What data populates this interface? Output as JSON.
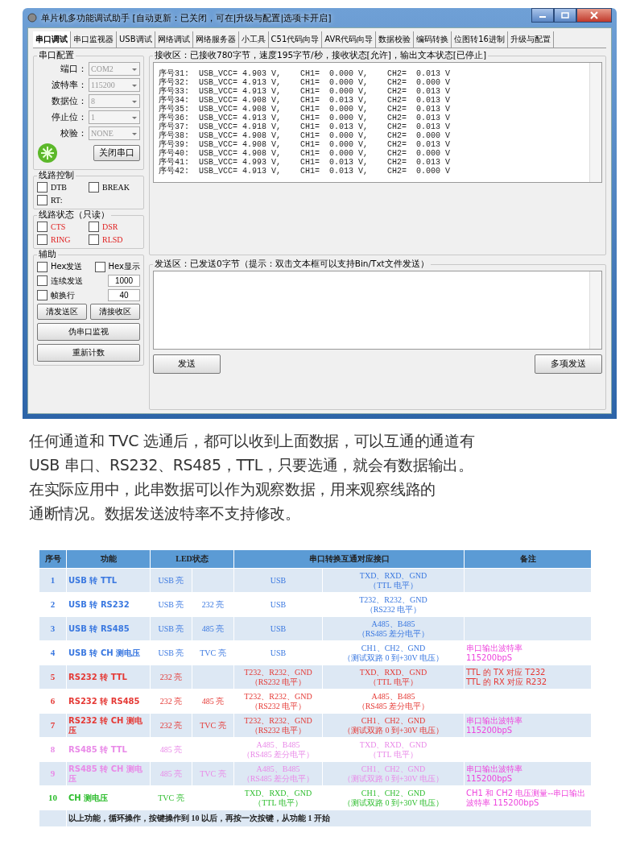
{
  "window": {
    "title": "单片机多功能调试助手 [自动更新：已关闭，可在|升级与配置|选项卡开启]"
  },
  "tabs": [
    {
      "label": "串口调试",
      "selected": true
    },
    {
      "label": "串口监视器",
      "selected": false
    },
    {
      "label": "USB调试",
      "selected": false
    },
    {
      "label": "网络调试",
      "selected": false
    },
    {
      "label": "网络服务器",
      "selected": false
    },
    {
      "label": "小工具",
      "selected": false
    },
    {
      "label": "C51代码向导",
      "selected": false
    },
    {
      "label": "AVR代码向导",
      "selected": false
    },
    {
      "label": "数据校验",
      "selected": false
    },
    {
      "label": "编码转换",
      "selected": false
    },
    {
      "label": "位图转16进制",
      "selected": false
    },
    {
      "label": "升级与配置",
      "selected": false
    }
  ],
  "serial_config": {
    "title": "串口配置",
    "fields": [
      {
        "label": "端口：",
        "value": "COM2",
        "disabled": true
      },
      {
        "label": "波特率：",
        "value": "115200",
        "disabled": true
      },
      {
        "label": "数据位：",
        "value": "8",
        "disabled": true
      },
      {
        "label": "停止位：",
        "value": "1",
        "disabled": true
      },
      {
        "label": "校验：",
        "value": "NONE",
        "disabled": true
      }
    ],
    "button": "关闭串口"
  },
  "line_control": {
    "title": "线路控制",
    "items": [
      {
        "label": "DTB",
        "checked": false
      },
      {
        "label": "BREAK",
        "checked": false
      },
      {
        "label": "RT:",
        "checked": false
      }
    ]
  },
  "line_status": {
    "title": "线路状态（只读）",
    "items": [
      {
        "label": "CTS",
        "checked": false
      },
      {
        "label": "DSR",
        "checked": false
      },
      {
        "label": "RING",
        "checked": false
      },
      {
        "label": "RLSD",
        "checked": false
      }
    ]
  },
  "assist": {
    "title": "辅助",
    "hex_send": {
      "label": "Hex发送",
      "checked": false
    },
    "hex_display": {
      "label": "Hex显示",
      "checked": false
    },
    "repeat_send": {
      "label": "连续发送",
      "checked": false,
      "value": "1000"
    },
    "frame_newline": {
      "label": "帧换行",
      "checked": false,
      "value": "40"
    },
    "buttons": [
      "清发送区",
      "清接收区",
      "伪串口监视",
      "重新计数"
    ]
  },
  "receive": {
    "title": "接收区：已接收780字节，速度195字节/秒，接收状态[允许]，输出文本状态[已停止]",
    "lines": [
      "序号31:  USB_VCC= 4.903 V,    CH1=  0.000 V,    CH2=  0.013 V",
      "序号32:  USB_VCC= 4.913 V,    CH1=  0.000 V,    CH2=  0.000 V",
      "序号33:  USB_VCC= 4.913 V,    CH1=  0.000 V,    CH2=  0.013 V",
      "序号34:  USB_VCC= 4.908 V,    CH1=  0.013 V,    CH2=  0.013 V",
      "序号35:  USB_VCC= 4.908 V,    CH1=  0.000 V,    CH2=  0.013 V",
      "序号36:  USB_VCC= 4.913 V,    CH1=  0.000 V,    CH2=  0.013 V",
      "序号37:  USB_VCC= 4.918 V,    CH1=  0.013 V,    CH2=  0.013 V",
      "序号38:  USB_VCC= 4.908 V,    CH1=  0.000 V,    CH2=  0.000 V",
      "序号39:  USB_VCC= 4.908 V,    CH1=  0.000 V,    CH2=  0.013 V",
      "序号40:  USB_VCC= 4.908 V,    CH1=  0.000 V,    CH2=  0.000 V",
      "序号41:  USB_VCC= 4.993 V,    CH1=  0.013 V,    CH2=  0.013 V",
      "序号42:  USB_VCC= 4.913 V,    CH1=  0.013 V,    CH2=  0.000 V"
    ]
  },
  "send": {
    "title": "发送区：已发送0字节（提示：双击文本框可以支持Bin/Txt文件发送）",
    "buttons": [
      "发送",
      "多项发送"
    ]
  },
  "description": [
    "任何通道和 TVC 选通后，都可以收到上面数据，可以互通的通道有",
    "USB 串口、RS232、RS485，TTL，只要选通，就会有数据输出。",
    "在实际应用中，此串数据可以作为观察数据，用来观察线路的",
    "通断情况。数据发送波特率不支持修改。"
  ],
  "table": {
    "columns": [
      "序号",
      "功能",
      "LED状态",
      "串口转换互通对应接口",
      "备注"
    ],
    "rows": [
      {
        "color": "#3a78e0",
        "no": "1",
        "function": "USB 转 TTL",
        "led_1": "USB 亮",
        "led_2": "",
        "port_1": "USB",
        "port_2": "TXD、RXD、GND\n（TTL 电平）",
        "note": null
      },
      {
        "color": "#3a78e0",
        "no": "2",
        "function": "USB 转 RS232",
        "led_1": "USB 亮",
        "led_2": "232 亮",
        "port_1": "USB",
        "port_2": "T232、R232、GND\n（RS232 电平）",
        "note": null
      },
      {
        "color": "#3a78e0",
        "no": "3",
        "function": "USB 转 RS485",
        "led_1": "USB 亮",
        "led_2": "485 亮",
        "port_1": "USB",
        "port_2": "A485、B485\n（RS485 差分电平）",
        "note": null
      },
      {
        "color": "#3a78e0",
        "no": "4",
        "function": "USB 转 CH 测电压",
        "led_1": "USB 亮",
        "led_2": "TVC 亮",
        "port_1": "USB",
        "port_2": "CH1、CH2、GND\n（测试双路 0 到+30V 电压）",
        "note": {
          "text": "串口输出波特率\n115200bpS",
          "color": "#ee44dd"
        }
      },
      {
        "color": "#e53935",
        "no": "5",
        "function": "RS232 转 TTL",
        "led_1": "232 亮",
        "led_2": "",
        "port_1": "T232、R232、GND\n（RS232 电平）",
        "port_2": "TXD、RXD、GND\n（TTL 电平）",
        "note": {
          "text": "TTL 的 TX 对应 T232\nTTL 的 RX 对应 R232",
          "color": "#e53935"
        }
      },
      {
        "color": "#e53935",
        "no": "6",
        "function": "RS232 转 RS485",
        "led_1": "232 亮",
        "led_2": "485 亮",
        "port_1": "T232、R232、GND\n（RS232 电平）",
        "port_2": "A485、B485\n（RS485 差分电平）",
        "note": null
      },
      {
        "color": "#e53935",
        "no": "7",
        "function": "RS232 转 CH 测电压",
        "led_1": "232 亮",
        "led_2": "TVC 亮",
        "port_1": "T232、R232、GND\n（RS232 电平）",
        "port_2": "CH1、CH2、GND\n（测试双路 0 到+30V 电压）",
        "note": {
          "text": "串口输出波特率\n115200bpS",
          "color": "#ee44dd"
        }
      },
      {
        "color": "#e98ae8",
        "no": "8",
        "function": "RS485 转 TTL",
        "led_1": "485 亮",
        "led_2": "",
        "port_1": "A485、B485\n（RS485 差分电平）",
        "port_2": "TXD、RXD、GND\n（TTL 电平）",
        "note": null
      },
      {
        "color": "#e98ae8",
        "no": "9",
        "function": "RS485 转 CH 测电压",
        "led_1": "485 亮",
        "led_2": "TVC 亮",
        "port_1": "A485、B485\n（RS485 差分电平）",
        "port_2": "CH1、CH2、GND\n（测试双路 0 到+30V 电压）",
        "note": {
          "text": "串口输出波特率\n115200bpS",
          "color": "#ee44dd"
        }
      },
      {
        "color": "#2ebd2e",
        "no": "10",
        "function": "CH 测电压",
        "led_1": "TVC 亮",
        "led_2": "",
        "port_1": "TXD、RXD、GND\n（TTL 电平）",
        "port_2": "CH1、CH2、GND\n（测试双路 0 到+30V 电压）",
        "note": {
          "text": "CH1 和 CH2 电压测量--串口输出波特率 115200bpS",
          "color": "#ee44dd"
        }
      }
    ],
    "footer": "以上功能，循环操作，按键操作到 10 以后，再按一次按键，从功能 1 开始"
  }
}
